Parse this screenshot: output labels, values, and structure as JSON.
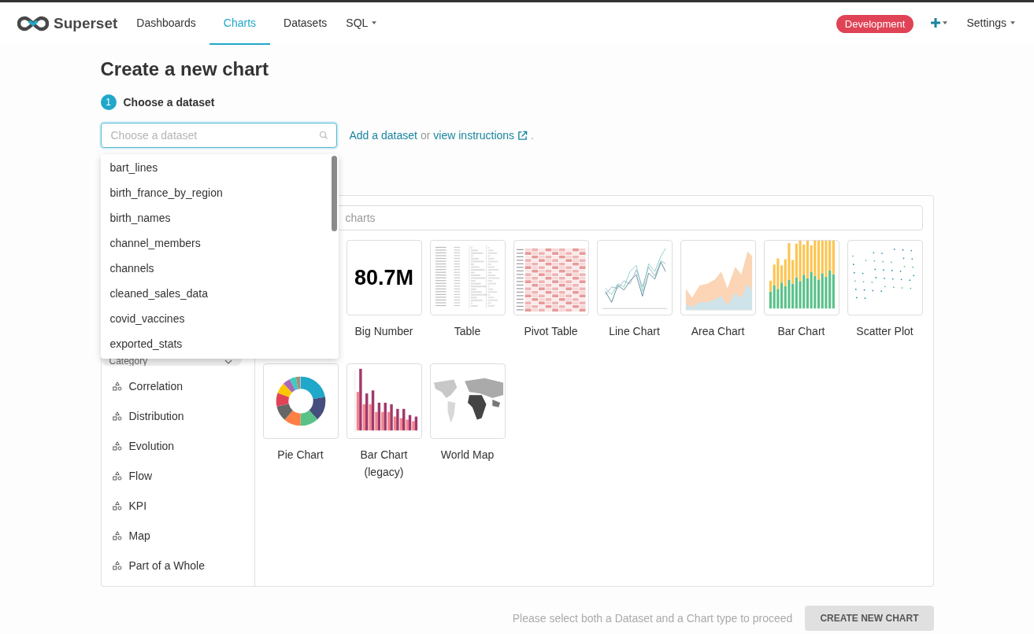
{
  "nav": {
    "brand": "Superset",
    "items": [
      {
        "label": "Dashboards",
        "selected": false,
        "dropdown": false
      },
      {
        "label": "Charts",
        "selected": true,
        "dropdown": false
      },
      {
        "label": "Datasets",
        "selected": false,
        "dropdown": false
      },
      {
        "label": "SQL",
        "selected": false,
        "dropdown": true
      }
    ],
    "env_badge": "Development",
    "settings": "Settings"
  },
  "page": {
    "title": "Create a new chart"
  },
  "step1": {
    "number": "1",
    "label": "Choose a dataset",
    "select": {
      "placeholder": "Choose a dataset"
    },
    "add_link": "Add a dataset",
    "or": "or",
    "instructions_link": "view instructions",
    "period": "."
  },
  "dataset_menu": [
    {
      "label": "bart_lines"
    },
    {
      "label": "birth_france_by_region"
    },
    {
      "label": "birth_names"
    },
    {
      "label": "channel_members"
    },
    {
      "label": "channels"
    },
    {
      "label": "cleaned_sales_data"
    },
    {
      "label": "covid_vaccines"
    },
    {
      "label": "exported_stats"
    }
  ],
  "chart_panel": {
    "category_header": "Category",
    "search": {
      "placeholder": "charts"
    },
    "categories": [
      {
        "label": "Correlation",
        "selected": false
      },
      {
        "label": "Distribution",
        "selected": false
      },
      {
        "label": "Evolution",
        "selected": false
      },
      {
        "label": "Flow",
        "selected": false
      },
      {
        "label": "KPI",
        "selected": false
      },
      {
        "label": "Map",
        "selected": false
      },
      {
        "label": "Part of a Whole",
        "selected": false
      }
    ],
    "chart_types": [
      {
        "label": "Big Number",
        "kind": "big_number",
        "thumb_text": "80.7M",
        "selected": false
      },
      {
        "label": "Table",
        "kind": "table",
        "selected": false
      },
      {
        "label": "Pivot Table",
        "kind": "pivot",
        "selected": false
      },
      {
        "label": "Line Chart",
        "kind": "line",
        "selected": false
      },
      {
        "label": "Area Chart",
        "kind": "area",
        "selected": false
      },
      {
        "label": "Bar Chart",
        "kind": "bar",
        "selected": false
      },
      {
        "label": "Scatter Plot",
        "kind": "scatter",
        "selected": false
      },
      {
        "label": "Pie Chart",
        "kind": "pie",
        "selected": false
      },
      {
        "label": "Bar Chart (legacy)",
        "kind": "bar_legacy",
        "selected": false
      },
      {
        "label": "World Map",
        "kind": "map",
        "selected": false
      }
    ]
  },
  "footer": {
    "hint": "Please select both a Dataset and a Chart type to proceed",
    "button": "CREATE NEW CHART",
    "button_disabled": true
  }
}
